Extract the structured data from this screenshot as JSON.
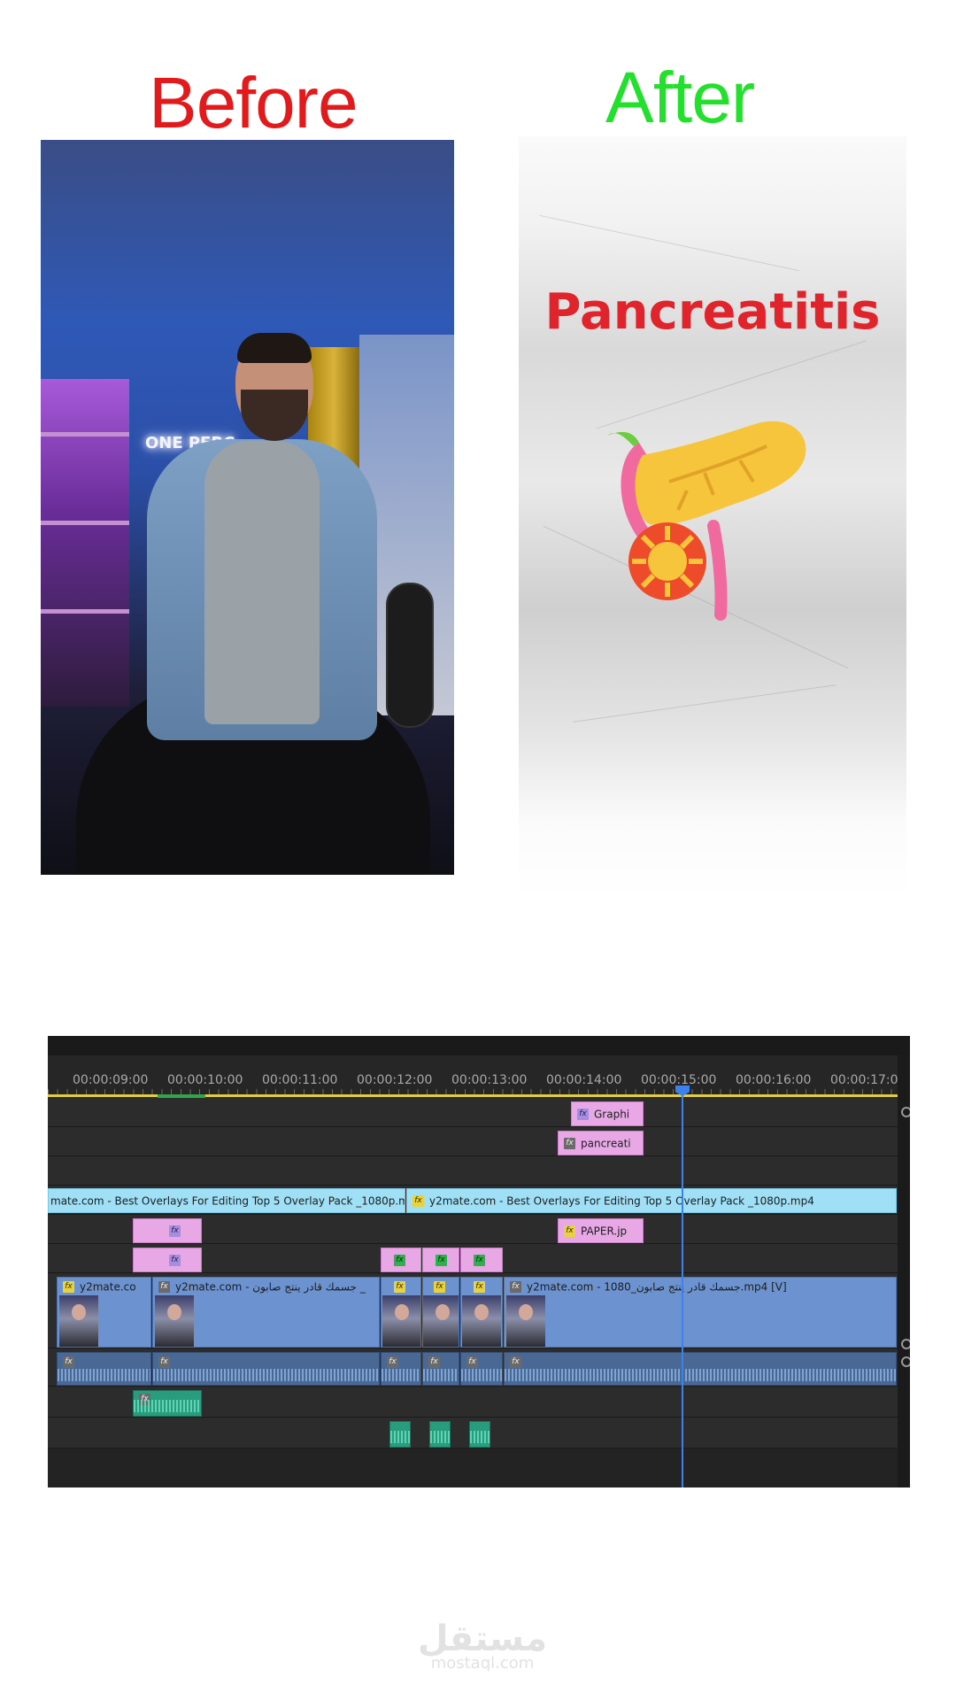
{
  "headings": {
    "before": "Before",
    "after": "After"
  },
  "before_panel": {
    "neon_sign": "ONE PERC"
  },
  "after_panel": {
    "title": "Pancreatitis"
  },
  "timeline": {
    "timecodes": [
      "00:00:09:00",
      "00:00:10:00",
      "00:00:11:00",
      "00:00:12:00",
      "00:00:13:00",
      "00:00:14:00",
      "00:00:15:00",
      "00:00:16:00",
      "00:00:17:00"
    ],
    "clips": {
      "graphic": "Graphi",
      "pancreas": "pancreati",
      "overlay_left": "mate.com - Best Overlays For Editing  Top 5 Overlay Pack  _1080p.mp4",
      "overlay_right": "y2mate.com - Best Overlays For Editing  Top 5 Overlay Pack  _1080p.mp4",
      "paper": "PAPER.jp",
      "main_1": "y2mate.co",
      "main_2": "y2mate.com - جسمك قادر ينتج صابون _",
      "main_3": "y2mate.com - 1080_جسمك قادر ينتج صابون.mp4 [V]"
    }
  },
  "watermark": {
    "arabic": "مستقل",
    "latin": "mostaql.com"
  },
  "colors": {
    "before": "#e31a1c",
    "after": "#22e02b",
    "title_red": "#e1232c",
    "playhead": "#3b82f0"
  }
}
